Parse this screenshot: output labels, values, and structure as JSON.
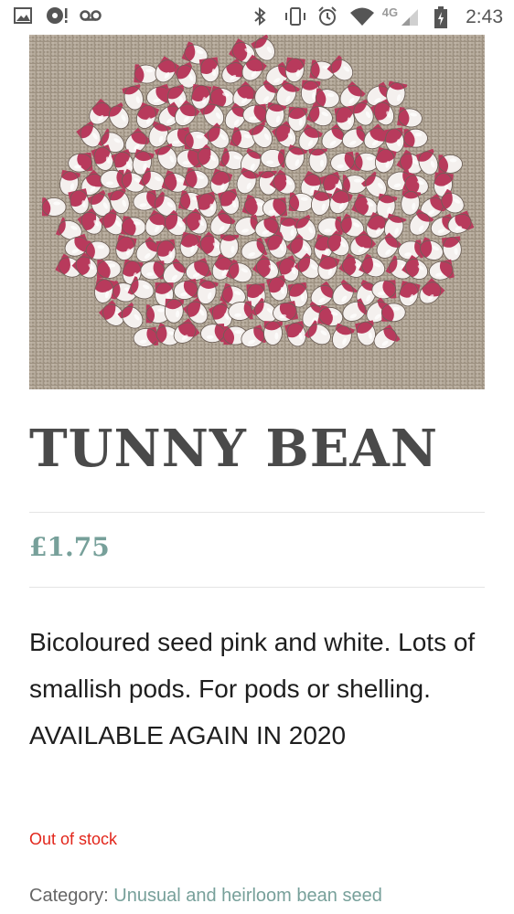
{
  "status_bar": {
    "time": "2:43",
    "network": "4G",
    "left_icons": [
      "image-icon",
      "music-alert-icon",
      "voicemail-icon"
    ],
    "right_icons": [
      "bluetooth-icon",
      "vibrate-icon",
      "alarm-icon",
      "wifi-icon",
      "cellular-signal-icon",
      "battery-charging-icon"
    ]
  },
  "product": {
    "image_alt": "photo of pink and white bicoloured beans on burlap",
    "title": "TUNNY BEAN",
    "price": "£1.75",
    "description": "Bicoloured seed pink and white. Lots of smallish pods. For pods or shelling.  AVAILABLE AGAIN IN 2020",
    "stock_status": "Out of stock",
    "category_label": "Category:",
    "category_link": "Unusual and heirloom bean seed"
  },
  "colors": {
    "accent": "#77a09a",
    "title": "#4a4a4a",
    "out_of_stock": "#e2261b",
    "bean_pink": "#b83a5c",
    "burlap": "#a89c8c"
  }
}
